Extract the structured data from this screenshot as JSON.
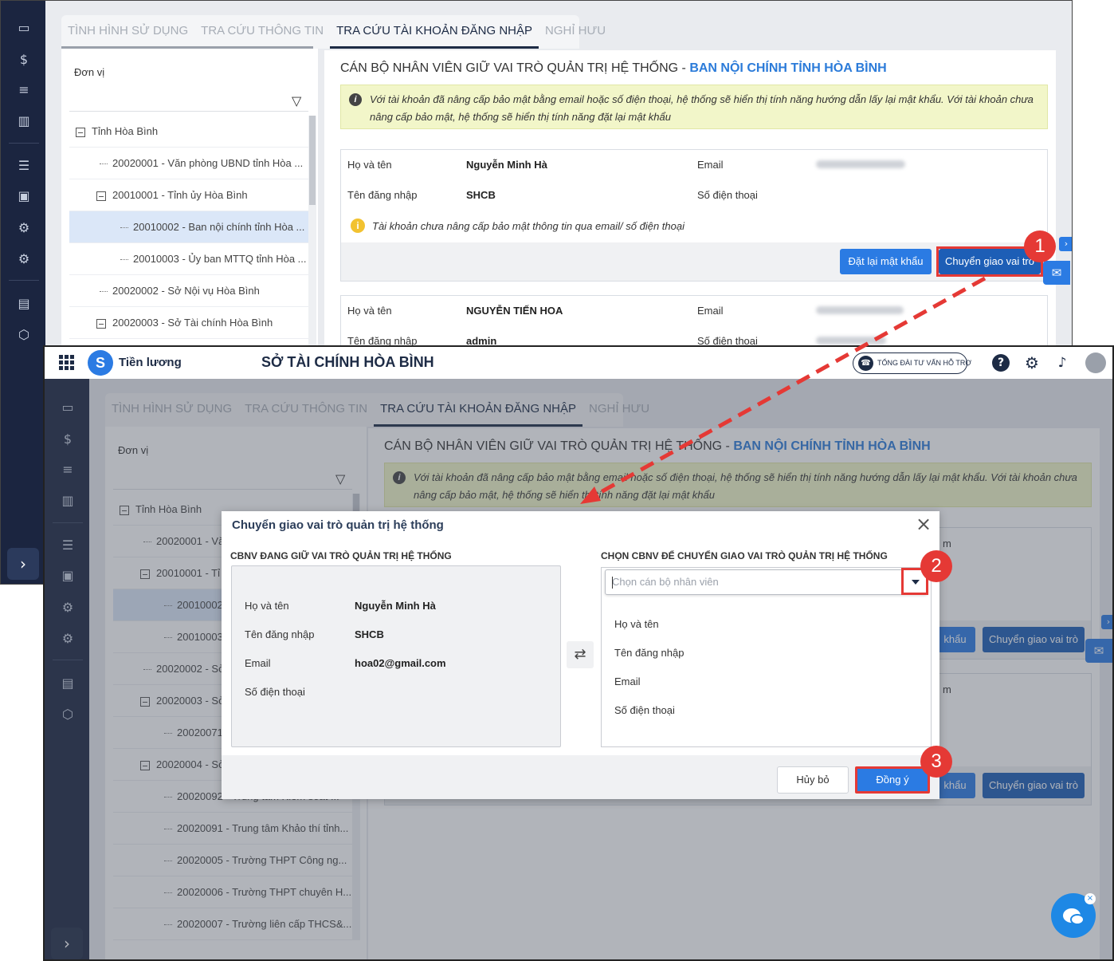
{
  "tabs": [
    "TÌNH HÌNH SỬ DỤNG",
    "TRA CỨU THÔNG TIN",
    "TRA CỨU TÀI KHOẢN ĐĂNG NHẬP",
    "NGHỈ HƯU"
  ],
  "active_tab": "TRA CỨU TÀI KHOẢN ĐĂNG NHẬP",
  "tree": {
    "title": "Đơn vị",
    "items_bg": [
      "Tỉnh Hòa Bình",
      "20020001 - Văn phòng UBND tỉnh Hòa ...",
      "20010001 - Tỉnh ủy Hòa Bình",
      "20010002 - Ban nội chính tỉnh Hòa ...",
      "20010003 - Ủy ban MTTQ tỉnh Hòa ...",
      "20020002 - Sở Nội vụ Hòa Bình",
      "20020003 - Sở Tài chính Hòa Bình"
    ],
    "items_fg": [
      "Tỉnh Hòa Bình",
      "20020001 - Vă",
      "20010001 - Tỉ",
      "20010002",
      "20010003",
      "20020002 - Sở",
      "20020003 - Sở",
      "20020071",
      "20020004 - Sở",
      "20020092 - Trung tâm Kiểm soát ...",
      "20020091 - Trung tâm Khảo thí tỉnh...",
      "20020005 - Trường THPT Công ng...",
      "20020006 - Trường THPT chuyên H...",
      "20020007 - Trường liên cấp THCS&..."
    ]
  },
  "content": {
    "title_prefix": "CÁN BỘ NHÂN VIÊN GIỮ VAI TRÒ QUẢN TRỊ HỆ THỐNG - ",
    "title_unit": "BAN NỘI CHÍNH TỈNH HÒA BÌNH",
    "info": "Với tài khoản đã nâng cấp bảo mật bằng email hoặc số điện thoại, hệ thống sẽ hiển thị tính năng hướng dẫn lấy lại mật khẩu. Với tài khoản chưa nâng cấp bảo mật, hệ thống sẽ hiển thị tính năng đặt lại mật khẩu",
    "labels": {
      "name": "Họ và tên",
      "username": "Tên đăng nhập",
      "email": "Email",
      "phone": "Số điện thoại"
    },
    "card1": {
      "name": "Nguyễn Minh Hà",
      "username": "SHCB",
      "warning": "Tài khoản chưa nâng cấp bảo mật thông tin qua email/ số điện thoại"
    },
    "card2": {
      "name": "NGUYỄN TIẾN HOA",
      "username": "admin"
    },
    "buttons": {
      "reset_password": "Đặt lại mật khẩu",
      "transfer_role": "Chuyển giao vai trò",
      "reset_partial": "khẩu"
    },
    "partial_m": "m"
  },
  "header": {
    "app_name": "Tiền lương",
    "org_name": "SỞ TÀI CHÍNH HÒA BÌNH",
    "hotline": "TỔNG ĐÀI TƯ VẤN HỖ TRỢ"
  },
  "modal": {
    "title": "Chuyển giao vai trò quản trị hệ thống",
    "left_title": "CBNV ĐANG GIỮ VAI TRÒ QUẢN TRỊ HỆ THỐNG",
    "right_title": "CHỌN CBNV ĐỂ CHUYỂN GIAO VAI TRÒ QUẢN TRỊ HỆ THỐNG",
    "current": {
      "name": "Nguyễn Minh Hà",
      "username": "SHCB",
      "email": "hoa02@gmail.com",
      "phone": ""
    },
    "select_placeholder": "Chọn cán bộ nhân viên",
    "cancel": "Hủy bỏ",
    "ok": "Đồng ý"
  },
  "steps": [
    "1",
    "2",
    "3"
  ],
  "colors": {
    "sidebar": "#1b2540",
    "accent": "#2b7be3",
    "highlight": "#e53935",
    "info_bg": "#f2f6c9"
  }
}
